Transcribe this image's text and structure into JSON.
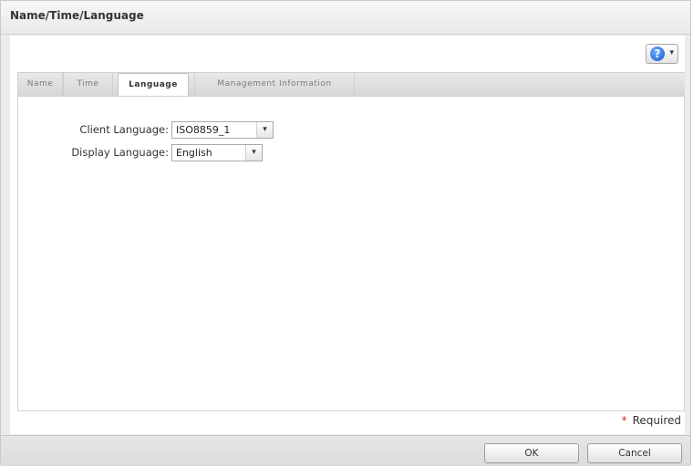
{
  "dialog": {
    "title": "Name/Time/Language"
  },
  "help": {
    "icon": "question-icon",
    "glyph": "?",
    "caret": "▾"
  },
  "tabs": [
    {
      "label": "Name",
      "active": false
    },
    {
      "label": "Time",
      "active": false
    },
    {
      "label": "Language",
      "active": true
    },
    {
      "label": "Management Information",
      "active": false
    }
  ],
  "form": {
    "client_language": {
      "label": "Client Language:",
      "value": "ISO8859_1"
    },
    "display_language": {
      "label": "Display Language:",
      "value": "English"
    }
  },
  "required_note": {
    "star": "*",
    "text": "Required"
  },
  "buttons": {
    "ok": "OK",
    "cancel": "Cancel"
  },
  "colors": {
    "required_star": "#e0231a",
    "help_icon": "#1b5fcf"
  }
}
